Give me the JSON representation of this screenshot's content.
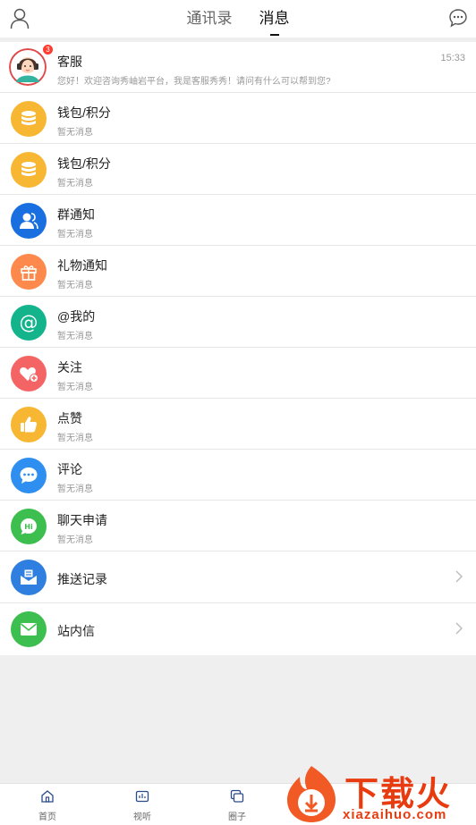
{
  "header": {
    "tabs": [
      {
        "label": "通讯录"
      },
      {
        "label": "消息"
      }
    ]
  },
  "messages": [
    {
      "title": "客服",
      "subtitle": "您好！欢迎咨询秀岫岩平台，我是客服秀秀！请问有什么可以帮到您?",
      "time": "15:33",
      "badge": "3",
      "icon": "customer-service-avatar"
    },
    {
      "title": "钱包/积分",
      "subtitle": "暂无消息",
      "icon": "coins-icon",
      "color": "#f7b733"
    },
    {
      "title": "钱包/积分",
      "subtitle": "暂无消息",
      "icon": "coins-icon",
      "color": "#f7b733"
    },
    {
      "title": "群通知",
      "subtitle": "暂无消息",
      "icon": "group-icon",
      "color": "#1a6fe0"
    },
    {
      "title": "礼物通知",
      "subtitle": "暂无消息",
      "icon": "gift-icon",
      "color": "#fd8a4c"
    },
    {
      "title": "@我的",
      "subtitle": "暂无消息",
      "icon": "at-icon",
      "color": "#13b38c"
    },
    {
      "title": "关注",
      "subtitle": "暂无消息",
      "icon": "heart-plus-icon",
      "color": "#f56464"
    },
    {
      "title": "点赞",
      "subtitle": "暂无消息",
      "icon": "thumbs-up-icon",
      "color": "#f7b733"
    },
    {
      "title": "评论",
      "subtitle": "暂无消息",
      "icon": "comment-icon",
      "color": "#2f8ff0"
    },
    {
      "title": "聊天申请",
      "subtitle": "暂无消息",
      "icon": "hi-chat-icon",
      "color": "#3cbf4f"
    }
  ],
  "links": [
    {
      "title": "推送记录",
      "icon": "push-record-icon",
      "color": "#2f7fe0"
    },
    {
      "title": "站内信",
      "icon": "mail-icon",
      "color": "#3cbf4f"
    }
  ],
  "footer": {
    "nav": [
      {
        "label": "首页",
        "icon": "home-icon"
      },
      {
        "label": "视听",
        "icon": "media-icon"
      },
      {
        "label": "圈子",
        "icon": "circle-icon"
      }
    ]
  },
  "watermark": {
    "title": "下载火",
    "domain": "xiazaihuo.com"
  },
  "colors": {
    "accent": "#111111",
    "badge": "#ff3b30",
    "watermark": "#e83b10"
  }
}
